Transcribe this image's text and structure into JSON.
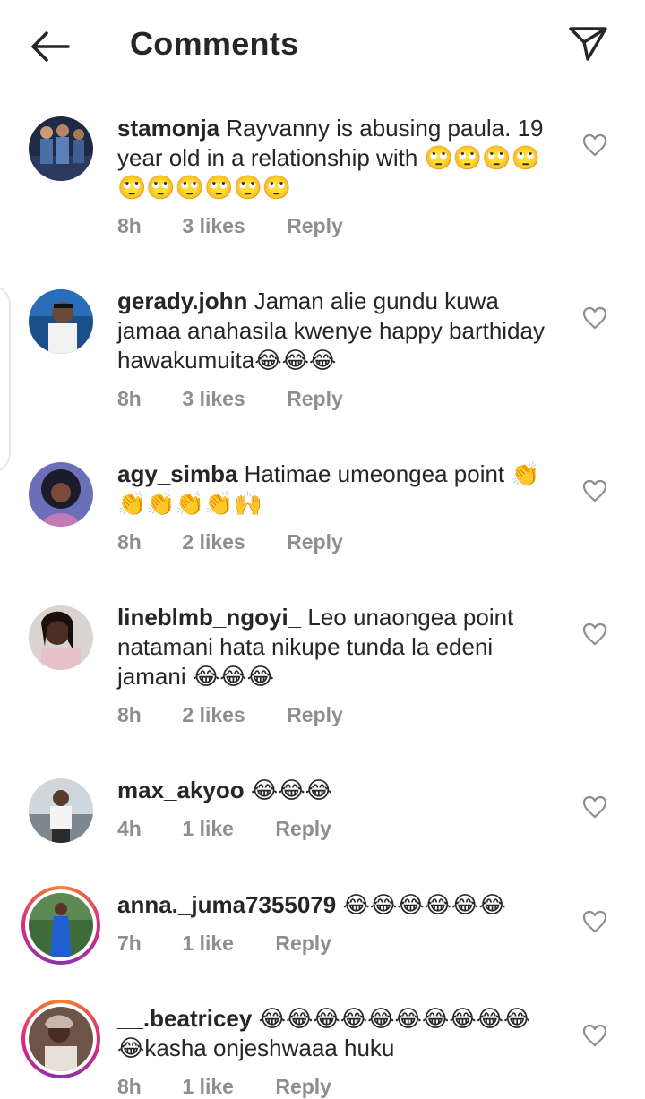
{
  "header": {
    "title": "Comments",
    "back_icon": "arrow-left-icon",
    "send_icon": "paper-plane-icon"
  },
  "colors": {
    "text": "#262626",
    "meta": "#8e8e8e",
    "story_ring": [
      "#f58529",
      "#dd2a7b",
      "#8134af"
    ]
  },
  "comments": [
    {
      "username": "stamonja",
      "text": "Rayvanny is abusing paula. 19 year old in a relationship with 🙄🙄🙄🙄🙄🙄🙄🙄🙄🙄",
      "time": "8h",
      "likes": "3 likes",
      "reply": "Reply"
    },
    {
      "username": "gerady.john",
      "text": "Jaman alie gundu kuwa jamaa anahasila kwenye happy barthiday hawakumuita😂😂😂",
      "time": "8h",
      "likes": "3 likes",
      "reply": "Reply"
    },
    {
      "username": "agy_simba",
      "text": "Hatimae umeongea point 👏👏👏👏👏🙌",
      "time": "8h",
      "likes": "2 likes",
      "reply": "Reply"
    },
    {
      "username": "lineblmb_ngoyi_",
      "text": "Leo unaongea point natamani hata nikupe tunda la edeni jamani 😂😂😂",
      "time": "8h",
      "likes": "2 likes",
      "reply": "Reply"
    },
    {
      "username": "max_akyoo",
      "text": "😂😂😂",
      "time": "4h",
      "likes": "1 like",
      "reply": "Reply"
    },
    {
      "username": "anna._juma7355079",
      "text": "😂😂😂😂😂😂",
      "time": "7h",
      "likes": "1 like",
      "reply": "Reply"
    },
    {
      "username": "__.beatricey",
      "text": "😂😂😂😂😂😂😂😂😂😂😂kasha onjeshwaaa huku",
      "time": "8h",
      "likes": "1 like",
      "reply": "Reply"
    }
  ]
}
